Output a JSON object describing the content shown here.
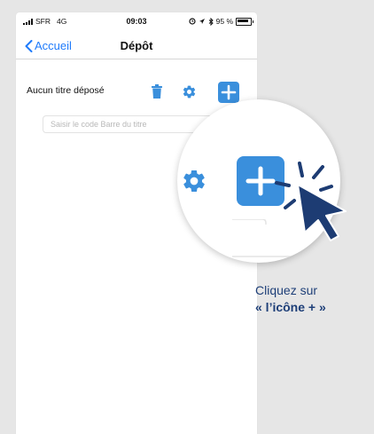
{
  "status_bar": {
    "carrier": "SFR",
    "network": "4G",
    "time": "09:03",
    "battery": "95 %"
  },
  "nav": {
    "back_label": "Accueil",
    "title": "Dépôt"
  },
  "toolbar": {
    "empty_label": "Aucun titre déposé",
    "icons": [
      "trash-icon",
      "gear-icon",
      "plus-icon"
    ]
  },
  "barcode_input": {
    "value": "",
    "placeholder": "Saisir le code Barre du titre"
  },
  "callout": {
    "line1": "Cliquez sur",
    "line2": "« l’icône + »"
  },
  "colors": {
    "accent_blue": "#3a8fdc",
    "ios_link_blue": "#1f7bfb",
    "callout_navy": "#1e3f78",
    "cursor_navy": "#1d3c73",
    "background": "#e6e6e6"
  }
}
